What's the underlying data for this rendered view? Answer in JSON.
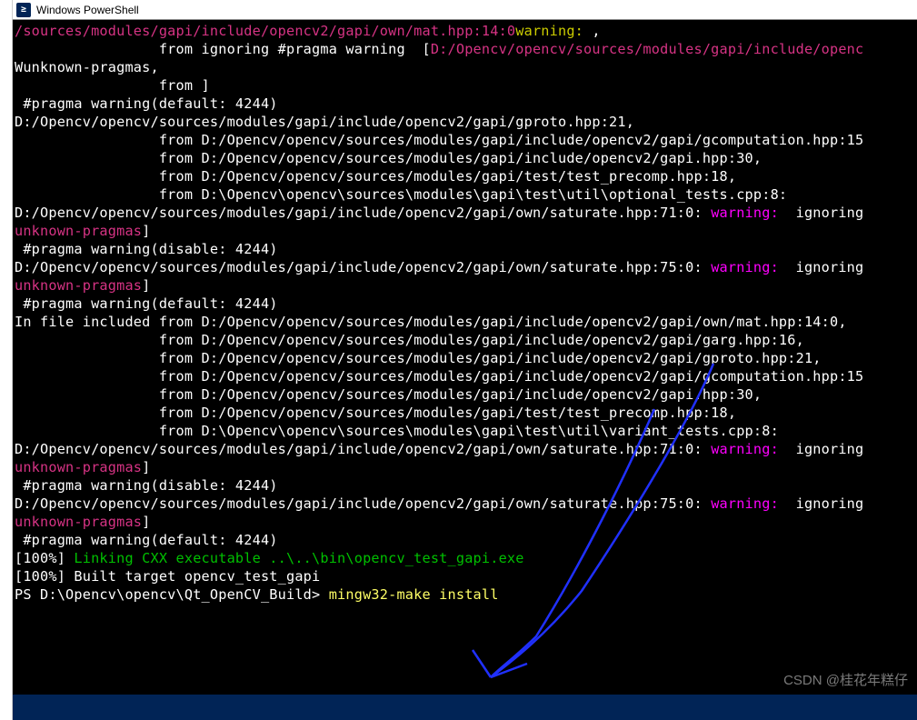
{
  "window": {
    "title": "Windows PowerShell"
  },
  "terminal": {
    "lines": [
      {
        "segments": [
          {
            "cls": "c-magenta",
            "t": "/sources/modules/gapi/include/opencv2/gapi/own/mat.hpp:14:0"
          },
          {
            "cls": "c-yellow",
            "t": "warning: "
          },
          {
            "cls": "c-white",
            "t": ","
          }
        ]
      },
      {
        "segments": [
          {
            "cls": "c-white",
            "t": "                 from ignoring #pragma warning  ["
          },
          {
            "cls": "c-magenta",
            "t": "D:/Opencv/opencv/sources/modules/gapi/include/openc"
          }
        ]
      },
      {
        "segments": [
          {
            "cls": "c-white",
            "t": "Wunknown-pragmas,"
          }
        ]
      },
      {
        "segments": [
          {
            "cls": "c-white",
            "t": "                 from ]"
          }
        ]
      },
      {
        "segments": [
          {
            "cls": "c-white",
            "t": " #pragma warning(default: 4244)"
          }
        ]
      },
      {
        "segments": [
          {
            "cls": "c-white",
            "t": ""
          }
        ]
      },
      {
        "segments": [
          {
            "cls": "c-white",
            "t": "D:/Opencv/opencv/sources/modules/gapi/include/opencv2/gapi/gproto.hpp:21,"
          }
        ]
      },
      {
        "segments": [
          {
            "cls": "c-white",
            "t": "                 from D:/Opencv/opencv/sources/modules/gapi/include/opencv2/gapi/gcomputation.hpp:15"
          }
        ]
      },
      {
        "segments": [
          {
            "cls": "c-white",
            "t": "                 from D:/Opencv/opencv/sources/modules/gapi/include/opencv2/gapi.hpp:30,"
          }
        ]
      },
      {
        "segments": [
          {
            "cls": "c-white",
            "t": "                 from D:/Opencv/opencv/sources/modules/gapi/test/test_precomp.hpp:18,"
          }
        ]
      },
      {
        "segments": [
          {
            "cls": "c-white",
            "t": "                 from D:\\Opencv\\opencv\\sources\\modules\\gapi\\test\\util\\optional_tests.cpp:8:"
          }
        ]
      },
      {
        "segments": [
          {
            "cls": "c-white",
            "t": "D:/Opencv/opencv/sources/modules/gapi/include/opencv2/gapi/own/saturate.hpp:71:0: "
          },
          {
            "cls": "c-magenta2",
            "t": "warning: "
          },
          {
            "cls": "c-white",
            "t": " ignoring"
          }
        ]
      },
      {
        "segments": [
          {
            "cls": "c-magenta",
            "t": "unknown-pragmas"
          },
          {
            "cls": "c-white",
            "t": "]"
          }
        ]
      },
      {
        "segments": [
          {
            "cls": "c-white",
            "t": " #pragma warning(disable: 4244)"
          }
        ]
      },
      {
        "segments": [
          {
            "cls": "c-white",
            "t": ""
          }
        ]
      },
      {
        "segments": [
          {
            "cls": "c-white",
            "t": "D:/Opencv/opencv/sources/modules/gapi/include/opencv2/gapi/own/saturate.hpp:75:0: "
          },
          {
            "cls": "c-magenta2",
            "t": "warning: "
          },
          {
            "cls": "c-white",
            "t": " ignoring"
          }
        ]
      },
      {
        "segments": [
          {
            "cls": "c-magenta",
            "t": "unknown-pragmas"
          },
          {
            "cls": "c-white",
            "t": "]"
          }
        ]
      },
      {
        "segments": [
          {
            "cls": "c-white",
            "t": " #pragma warning(default: 4244)"
          }
        ]
      },
      {
        "segments": [
          {
            "cls": "c-white",
            "t": ""
          }
        ]
      },
      {
        "segments": [
          {
            "cls": "c-white",
            "t": "In file included from D:/Opencv/opencv/sources/modules/gapi/include/opencv2/gapi/own/mat.hpp:14:0,"
          }
        ]
      },
      {
        "segments": [
          {
            "cls": "c-white",
            "t": "                 from D:/Opencv/opencv/sources/modules/gapi/include/opencv2/gapi/garg.hpp:16,"
          }
        ]
      },
      {
        "segments": [
          {
            "cls": "c-white",
            "t": "                 from D:/Opencv/opencv/sources/modules/gapi/include/opencv2/gapi/gproto.hpp:21,"
          }
        ]
      },
      {
        "segments": [
          {
            "cls": "c-white",
            "t": "                 from D:/Opencv/opencv/sources/modules/gapi/include/opencv2/gapi/gcomputation.hpp:15"
          }
        ]
      },
      {
        "segments": [
          {
            "cls": "c-white",
            "t": "                 from D:/Opencv/opencv/sources/modules/gapi/include/opencv2/gapi.hpp:30,"
          }
        ]
      },
      {
        "segments": [
          {
            "cls": "c-white",
            "t": "                 from D:/Opencv/opencv/sources/modules/gapi/test/test_precomp.hpp:18,"
          }
        ]
      },
      {
        "segments": [
          {
            "cls": "c-white",
            "t": "                 from D:\\Opencv\\opencv\\sources\\modules\\gapi\\test\\util\\variant_tests.cpp:8:"
          }
        ]
      },
      {
        "segments": [
          {
            "cls": "c-white",
            "t": "D:/Opencv/opencv/sources/modules/gapi/include/opencv2/gapi/own/saturate.hpp:71:0: "
          },
          {
            "cls": "c-magenta2",
            "t": "warning: "
          },
          {
            "cls": "c-white",
            "t": " ignoring"
          }
        ]
      },
      {
        "segments": [
          {
            "cls": "c-magenta",
            "t": "unknown-pragmas"
          },
          {
            "cls": "c-white",
            "t": "]"
          }
        ]
      },
      {
        "segments": [
          {
            "cls": "c-white",
            "t": " #pragma warning(disable: 4244)"
          }
        ]
      },
      {
        "segments": [
          {
            "cls": "c-white",
            "t": ""
          }
        ]
      },
      {
        "segments": [
          {
            "cls": "c-white",
            "t": "D:/Opencv/opencv/sources/modules/gapi/include/opencv2/gapi/own/saturate.hpp:75:0: "
          },
          {
            "cls": "c-magenta2",
            "t": "warning: "
          },
          {
            "cls": "c-white",
            "t": " ignoring"
          }
        ]
      },
      {
        "segments": [
          {
            "cls": "c-magenta",
            "t": "unknown-pragmas"
          },
          {
            "cls": "c-white",
            "t": "]"
          }
        ]
      },
      {
        "segments": [
          {
            "cls": "c-white",
            "t": " #pragma warning(default: 4244)"
          }
        ]
      },
      {
        "segments": [
          {
            "cls": "c-white",
            "t": "[100%] "
          },
          {
            "cls": "c-green",
            "t": "Linking CXX executable ..\\..\\bin\\opencv_test_gapi.exe"
          }
        ]
      },
      {
        "segments": [
          {
            "cls": "c-white",
            "t": "[100%] Built target opencv_test_gapi"
          }
        ]
      },
      {
        "segments": [
          {
            "cls": "c-prompt",
            "t": "PS D:\\Opencv\\opencv\\Qt_OpenCV_Build> "
          },
          {
            "cls": "c-cmd",
            "t": "mingw32-make install"
          }
        ]
      }
    ]
  },
  "watermark": "CSDN @桂花年糕仔"
}
